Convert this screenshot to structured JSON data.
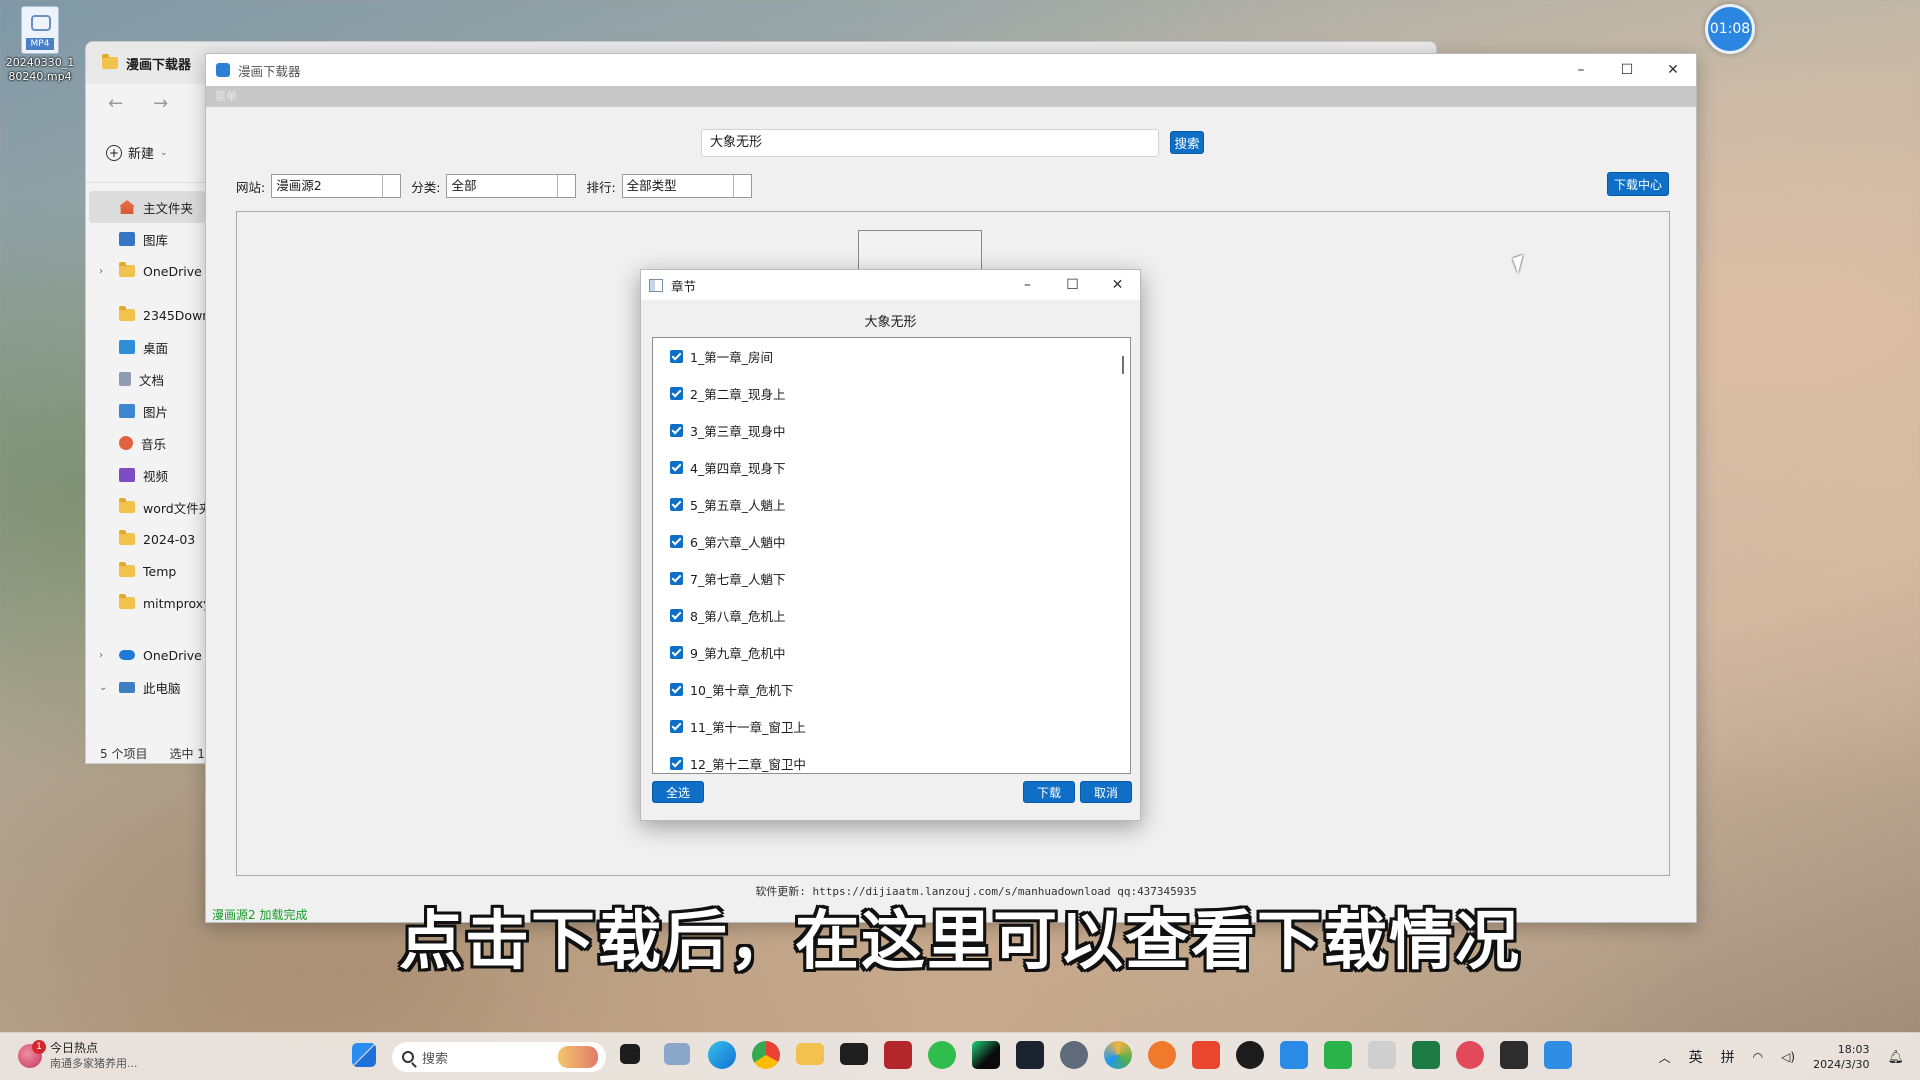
{
  "desktop": {
    "file_icon_tag": "MP4",
    "file_name": "20240330_1 80240.mp4",
    "timer": "01:08"
  },
  "explorer": {
    "tab_title": "漫画下载器",
    "new_button": "新建",
    "nav_items": [
      {
        "label": "主文件夹",
        "icon": "home-icon"
      },
      {
        "label": "图库",
        "icon": "gallery-icon"
      },
      {
        "label": "OneDrive",
        "icon": "folder-icon"
      },
      {
        "label": "2345Downl",
        "icon": "folder-icon"
      },
      {
        "label": "桌面",
        "icon": "desktop-icon"
      },
      {
        "label": "文档",
        "icon": "document-icon"
      },
      {
        "label": "图片",
        "icon": "picture-icon"
      },
      {
        "label": "音乐",
        "icon": "music-icon"
      },
      {
        "label": "视频",
        "icon": "video-icon"
      },
      {
        "label": "word文件夹",
        "icon": "folder-icon"
      },
      {
        "label": "2024-03",
        "icon": "folder-icon"
      },
      {
        "label": "Temp",
        "icon": "folder-icon"
      },
      {
        "label": "mitmproxy",
        "icon": "folder-icon"
      },
      {
        "label": "OneDrive",
        "icon": "cloud-icon"
      },
      {
        "label": "此电脑",
        "icon": "pc-icon"
      }
    ],
    "status_count": "5 个项目",
    "status_selected": "选中 1"
  },
  "app": {
    "title": "漫画下载器",
    "menu": "菜单",
    "search_value": "大象无形",
    "search_button": "搜索",
    "site_label": "网站:",
    "site_value": "漫画源2",
    "category_label": "分类:",
    "category_value": "全部",
    "rank_label": "排行:",
    "rank_value": "全部类型",
    "download_center": "下载中心",
    "footer": "软件更新: https://dijiaatm.lanzouj.com/s/manhuadownload  qq:437345935",
    "status": "漫画源2 加载完成",
    "accent": "#0f6fc6"
  },
  "dialog": {
    "title": "章节",
    "comic_title": "大象无形",
    "chapters": [
      "1_第一章_房间",
      "2_第二章_现身上",
      "3_第三章_现身中",
      "4_第四章_现身下",
      "5_第五章_人魈上",
      "6_第六章_人魈中",
      "7_第七章_人魈下",
      "8_第八章_危机上",
      "9_第九章_危机中",
      "10_第十章_危机下",
      "11_第十一章_窗卫上",
      "12_第十二章_窗卫中"
    ],
    "select_all": "全选",
    "download": "下载",
    "cancel": "取消"
  },
  "subtitle": "点击下载后，在这里可以查看下载情况",
  "taskbar": {
    "news_title": "今日热点",
    "news_sub": "南通多家猪养用...",
    "news_badge": "1",
    "search_placeholder": "搜索",
    "ime_lang": "英",
    "ime_mode": "拼",
    "time": "18:03",
    "date": "2024/3/30"
  }
}
